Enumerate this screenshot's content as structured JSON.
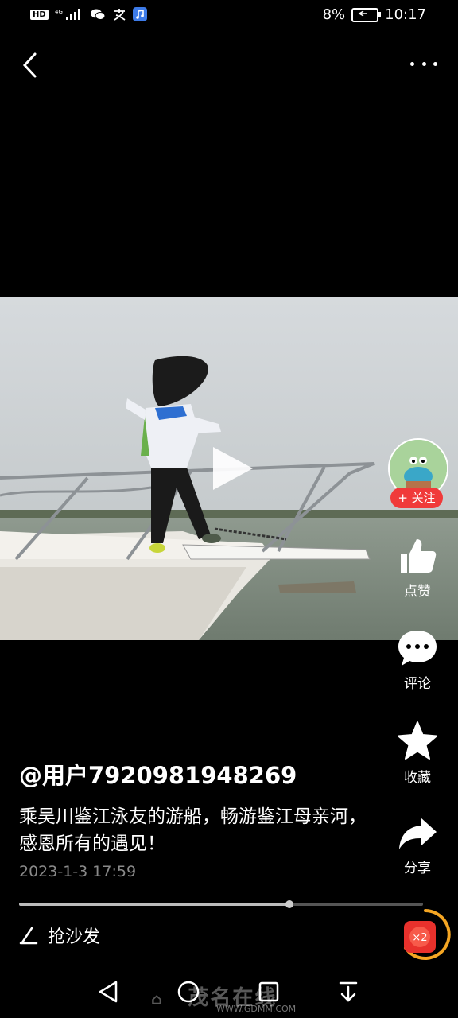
{
  "status_bar": {
    "hd": "HD",
    "network": "4G",
    "battery_percent": "8%",
    "time": "10:17",
    "icons": [
      "hd-icon",
      "signal-icon",
      "wechat-icon",
      "alipay-icon",
      "music-app-icon",
      "battery-icon"
    ]
  },
  "top_bar": {
    "back_icon": "chevron-left-icon",
    "more_icon": "more-horizontal-icon"
  },
  "video": {
    "play_icon": "play-icon",
    "progress": 0.67
  },
  "right_rail": {
    "follow_label": "+ 关注",
    "like_label": "点赞",
    "comment_label": "评论",
    "favorite_label": "收藏",
    "share_label": "分享"
  },
  "post": {
    "username": "@用户7920981948269",
    "caption": "乘吴川鉴江泳友的游船，畅游鉴江母亲河，感恩所有的遇见！",
    "datetime": "2023-1-3 17:59"
  },
  "comment_bar": {
    "label": "抢沙发",
    "reward_badge": "×2"
  },
  "nav_bar": {
    "watermark": "茂名在线",
    "watermark_url": "WWW.GDMM.COM"
  },
  "colors": {
    "background": "#000000",
    "follow_red": "#f03a3a",
    "reward_orange": "#f5a623",
    "date_gray": "#8a8a8a"
  }
}
